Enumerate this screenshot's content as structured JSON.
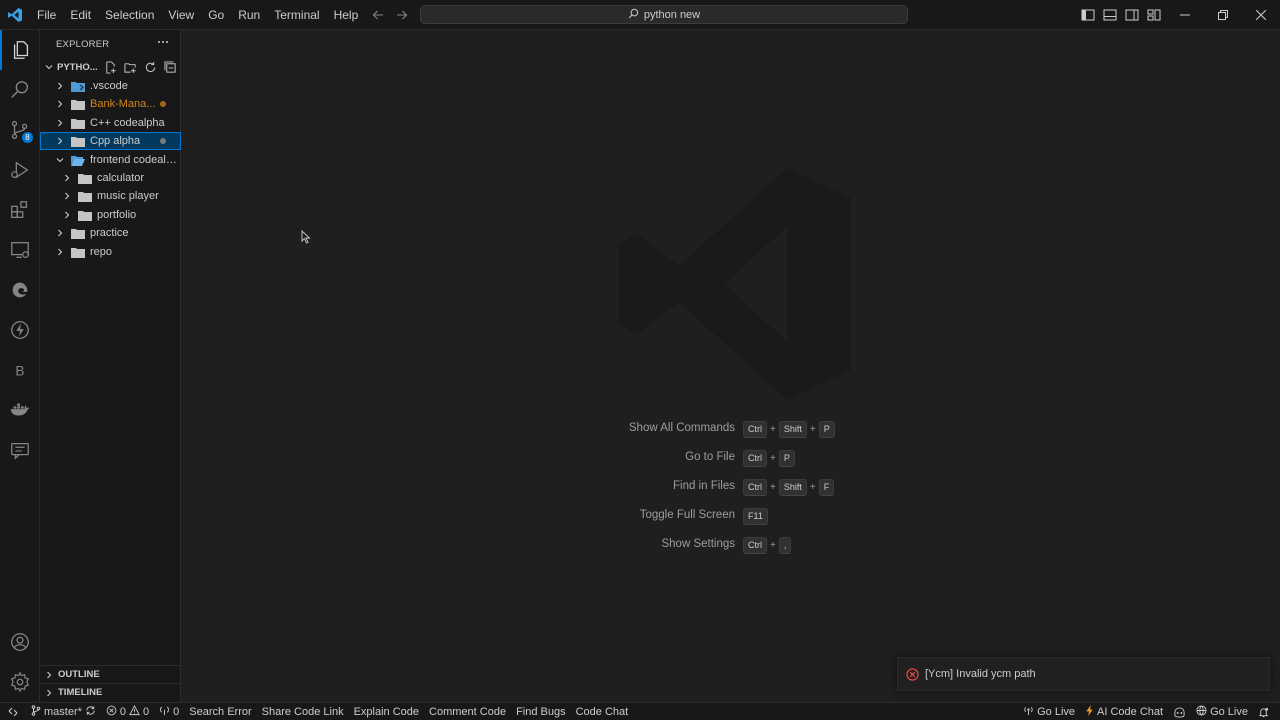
{
  "titlebar": {
    "menu": [
      "File",
      "Edit",
      "Selection",
      "View",
      "Go",
      "Run",
      "Terminal",
      "Help"
    ],
    "search_text": "python new"
  },
  "activity": {
    "source_control_badge": "8"
  },
  "explorer": {
    "header": "EXPLORER",
    "workspace": "PYTHO...",
    "items": [
      {
        "label": ".vscode",
        "color": "#cccccc"
      },
      {
        "label": "Bank-Mana...",
        "color": "#d18616"
      },
      {
        "label": "C++ codealpha",
        "color": "#cccccc"
      },
      {
        "label": "Cpp alpha",
        "color": "#cccccc"
      },
      {
        "label": "frontend codealp...",
        "color": "#cccccc"
      },
      {
        "label": "calculator",
        "color": "#cccccc"
      },
      {
        "label": "music player",
        "color": "#cccccc"
      },
      {
        "label": "portfolio",
        "color": "#cccccc"
      },
      {
        "label": "practice",
        "color": "#cccccc"
      },
      {
        "label": "repo",
        "color": "#cccccc"
      }
    ],
    "outline": "OUTLINE",
    "timeline": "TIMELINE"
  },
  "welcome": {
    "shortcuts": [
      {
        "label": "Show All Commands",
        "keys": [
          "Ctrl",
          "Shift",
          "P"
        ]
      },
      {
        "label": "Go to File",
        "keys": [
          "Ctrl",
          "P"
        ]
      },
      {
        "label": "Find in Files",
        "keys": [
          "Ctrl",
          "Shift",
          "F"
        ]
      },
      {
        "label": "Toggle Full Screen",
        "keys": [
          "F11"
        ]
      },
      {
        "label": "Show Settings",
        "keys": [
          "Ctrl",
          ","
        ]
      }
    ]
  },
  "notification": {
    "text": "[Ycm] Invalid ycm path"
  },
  "statusbar": {
    "branch": "master*",
    "errors": "0",
    "warnings": "0",
    "ports": "0",
    "left_items": [
      "Search Error",
      "Share Code Link",
      "Explain Code",
      "Comment Code",
      "Find Bugs",
      "Code Chat"
    ],
    "go_live_1": "Go Live",
    "ai_chat": "AI Code Chat",
    "go_live_2": "Go Live"
  },
  "colors": {
    "accent": "#0078d4",
    "modified_dot": "#d18616",
    "error": "#f14c4c"
  }
}
